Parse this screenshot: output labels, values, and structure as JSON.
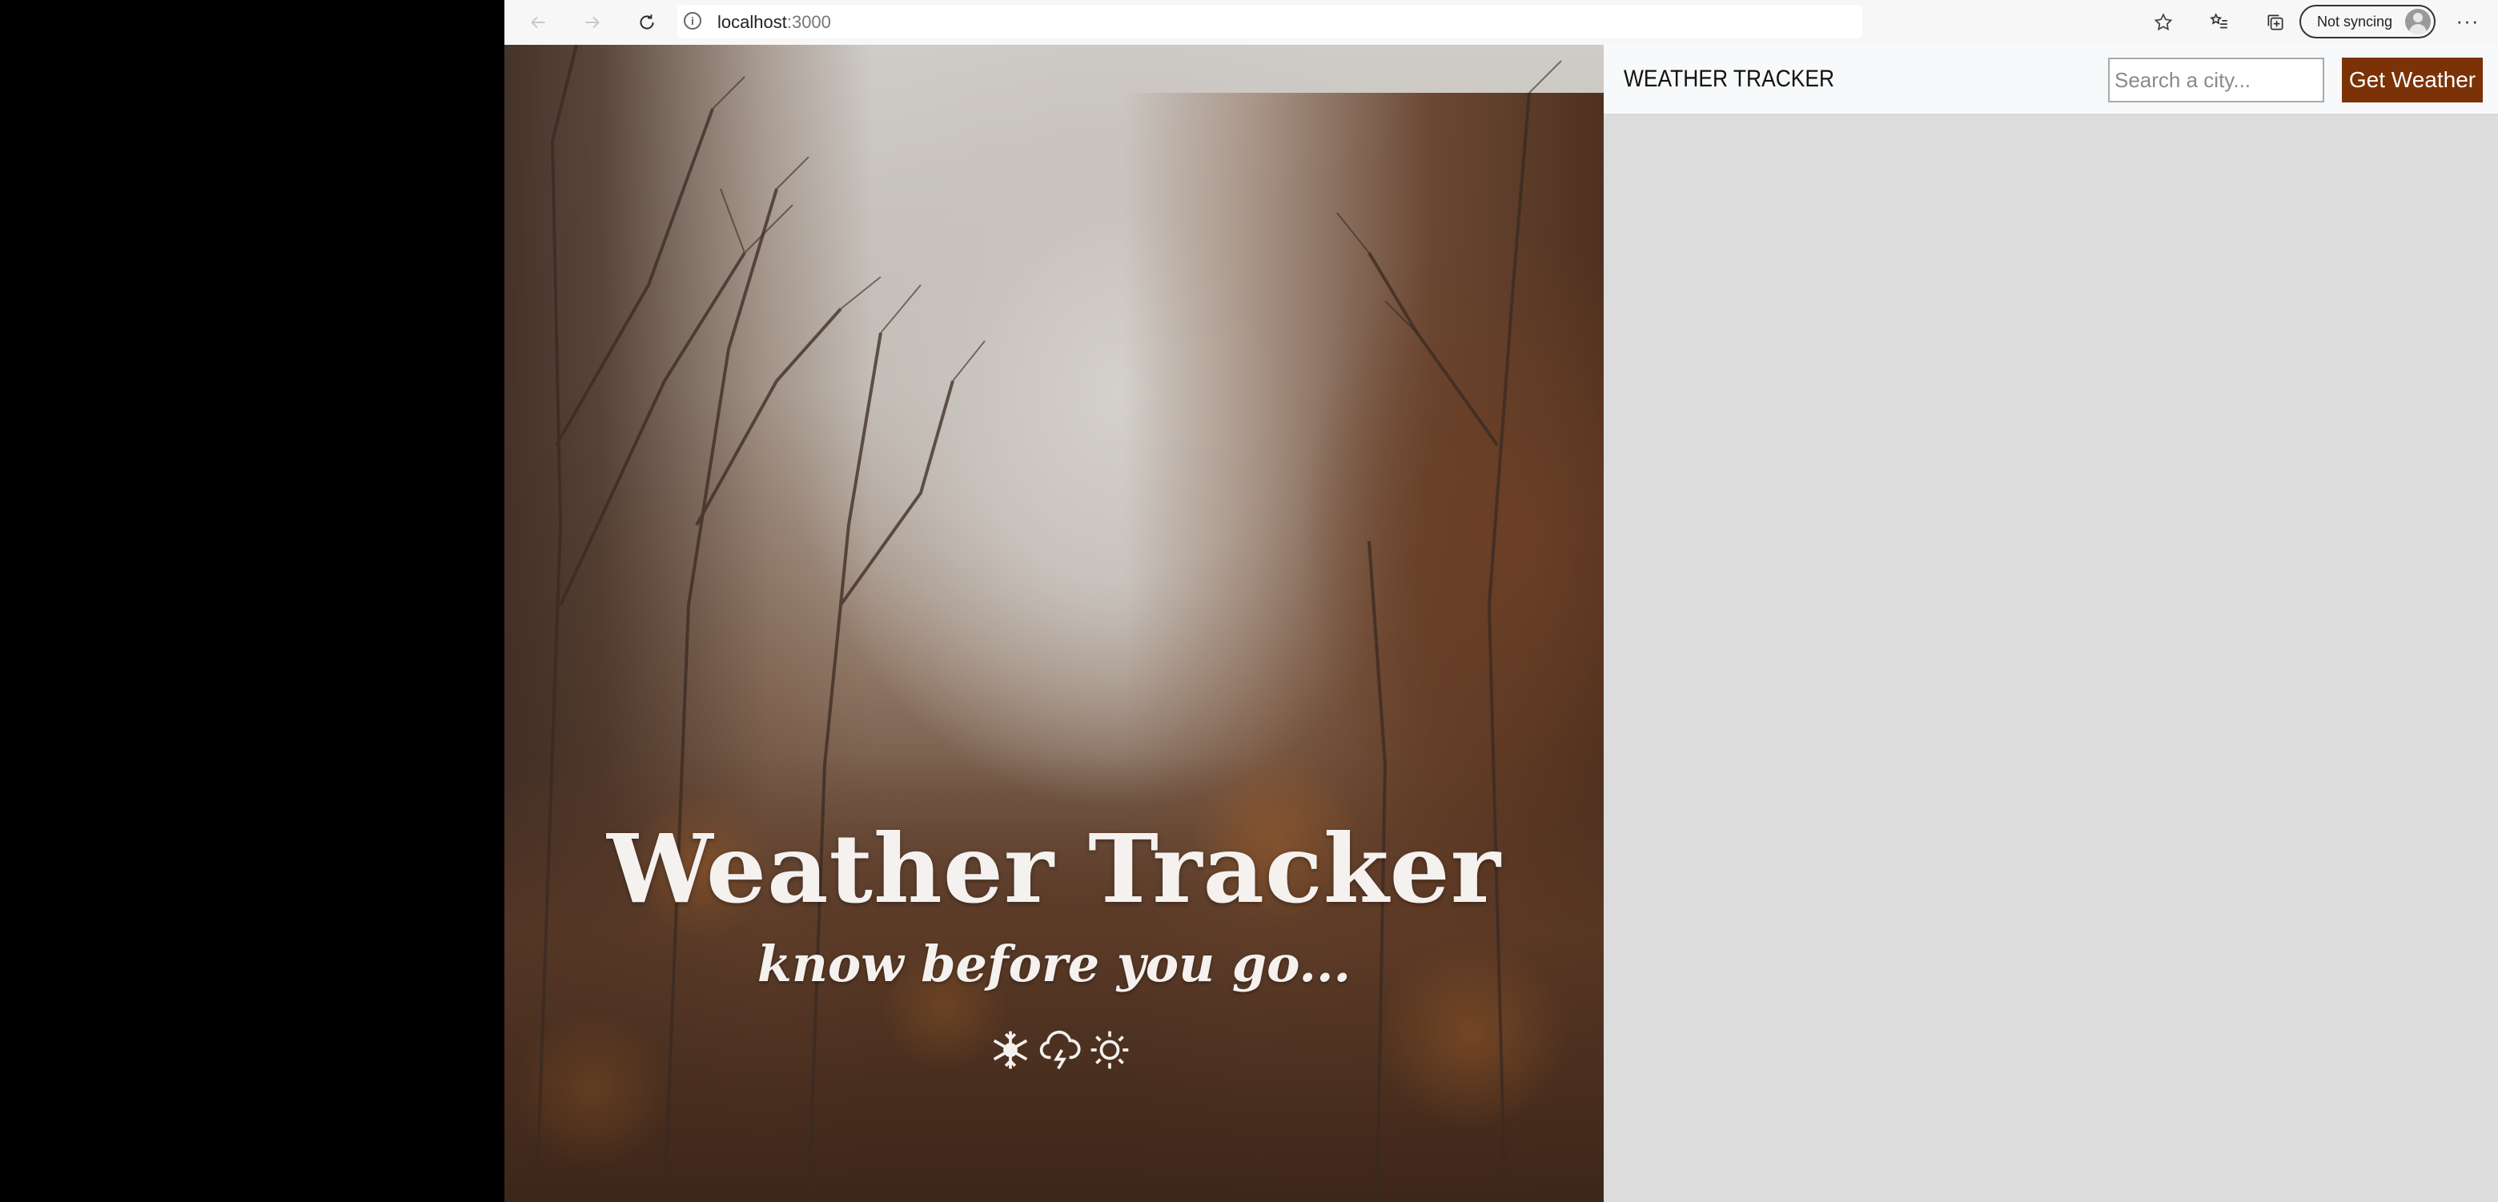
{
  "browser": {
    "url_host": "localhost",
    "url_port": ":3000",
    "sync_label": "Not syncing",
    "more_label": "···"
  },
  "hero": {
    "title": "Weather Tracker",
    "subtitle": "know before you go...",
    "icons": [
      "snowflake-icon",
      "cloud-lightning-icon",
      "sun-icon"
    ]
  },
  "navbar": {
    "brand": "WEATHER TRACKER",
    "search_placeholder": "Search a city...",
    "button_label": "Get Weather"
  },
  "colors": {
    "button": "#7b3207",
    "panel_bg": "#dcdcdc",
    "navbar_bg": "#f8f9fa"
  }
}
